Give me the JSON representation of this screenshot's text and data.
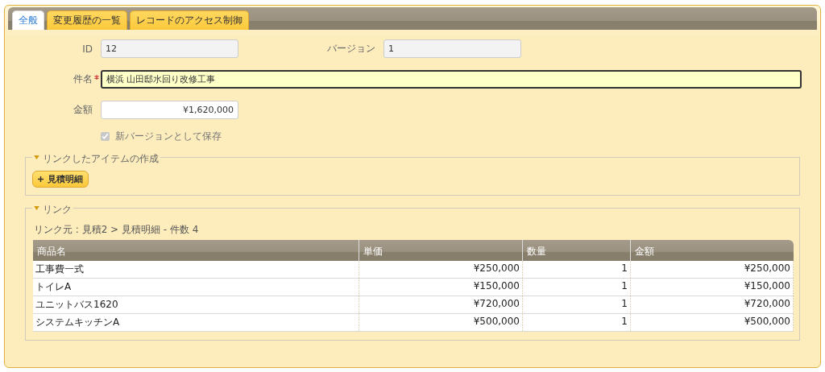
{
  "tabs": [
    {
      "label": "全般",
      "selected": true
    },
    {
      "label": "変更履歴の一覧",
      "selected": false
    },
    {
      "label": "レコードのアクセス制御",
      "selected": false
    }
  ],
  "fields": {
    "id": {
      "label": "ID",
      "value": "12",
      "disabled": true
    },
    "version": {
      "label": "バージョン",
      "value": "1",
      "disabled": true
    },
    "subject": {
      "label": "件名",
      "required": true,
      "value": "横浜 山田邸水回り改修工事"
    },
    "amount": {
      "label": "金額",
      "value": "¥1,620,000"
    },
    "save_new_version": {
      "label": "新バージョンとして保存",
      "checked": true,
      "disabled": true
    }
  },
  "create_section": {
    "title": "リンクしたアイテムの作成",
    "expanded": true,
    "button": "見積明細"
  },
  "link_section": {
    "title": "リンク",
    "expanded": true,
    "source": "リンク元 : 見積2 > 見積明細 - 件数 4",
    "table": {
      "columns": [
        "商品名",
        "単価",
        "数量",
        "金額"
      ],
      "rows": [
        [
          "工事費一式",
          "¥250,000",
          "1",
          "¥250,000"
        ],
        [
          "トイレA",
          "¥150,000",
          "1",
          "¥150,000"
        ],
        [
          "ユニットバス1620",
          "¥720,000",
          "1",
          "¥720,000"
        ],
        [
          "システムキッチンA",
          "¥500,000",
          "1",
          "¥500,000"
        ]
      ]
    }
  }
}
